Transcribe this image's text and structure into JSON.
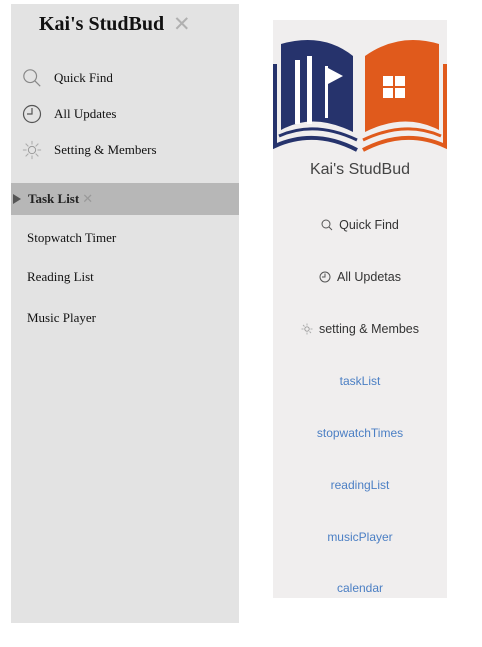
{
  "sidebar": {
    "workspace_title": "Kai's StudBud",
    "close_glyph": "✕",
    "top_items": [
      {
        "label": "Quick Find",
        "icon": "search-icon"
      },
      {
        "label": "All Updates",
        "icon": "clock-icon"
      },
      {
        "label": "Setting & Members",
        "icon": "gear-icon"
      }
    ],
    "selected_page": {
      "label": "Task List",
      "close_glyph": "✕"
    },
    "pages": [
      "Stopwatch Timer",
      "Reading List",
      "Music Player"
    ]
  },
  "app_nav": {
    "brand": "Kai's StudBud",
    "logo_colors": {
      "blue": "#26336c",
      "orange": "#e05a1c"
    },
    "items": [
      {
        "label": "Quick Find",
        "icon": "search-icon"
      },
      {
        "label": "All Updetas",
        "icon": "clock-icon"
      },
      {
        "label": "setting & Membes",
        "icon": "gear-icon"
      }
    ],
    "links": [
      "taskList",
      "stopwatchTimes",
      "readingList",
      "musicPlayer",
      "calendar"
    ],
    "link_color": "#4b7fc4"
  }
}
